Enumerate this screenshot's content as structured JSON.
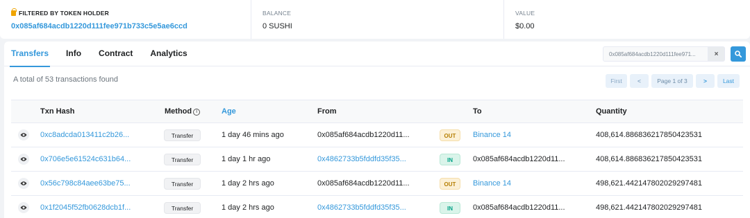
{
  "summary": {
    "holder_label": "FILTERED BY TOKEN HOLDER",
    "holder_address": "0x085af684acdb1220d111fee971b733c5e5ae6ccd",
    "balance_label": "BALANCE",
    "balance_value": "0 SUSHI",
    "value_label": "VALUE",
    "value_value": "$0.00"
  },
  "tabs": [
    {
      "label": "Transfers",
      "active": true
    },
    {
      "label": "Info"
    },
    {
      "label": "Contract"
    },
    {
      "label": "Analytics"
    }
  ],
  "search": {
    "value": "0x085af684acdb1220d111fee971...",
    "clear": "×"
  },
  "total_text": "A total of 53 transactions found",
  "pager": {
    "first": "First",
    "prev": "<",
    "page": "Page 1 of 3",
    "next": ">",
    "last": "Last"
  },
  "table": {
    "headers": {
      "txn_hash": "Txn Hash",
      "method": "Method",
      "info": "i",
      "age": "Age",
      "from": "From",
      "to": "To",
      "quantity": "Quantity"
    },
    "rows": [
      {
        "hash": "0xc8adcda013411c2b26...",
        "method": "Transfer",
        "age": "1 day 46 mins ago",
        "from": "0x085af684acdb1220d11...",
        "dir": "OUT",
        "to": "Binance 14",
        "quantity": "408,614.886836217850423531"
      },
      {
        "hash": "0x706e5e61524c631b64...",
        "method": "Transfer",
        "age": "1 day 1 hr ago",
        "from": "0x4862733b5fddfd35f35...",
        "dir": "IN",
        "to": "0x085af684acdb1220d11...",
        "quantity": "408,614.886836217850423531"
      },
      {
        "hash": "0x56c798c84aee63be75...",
        "method": "Transfer",
        "age": "1 day 2 hrs ago",
        "from": "0x085af684acdb1220d11...",
        "dir": "OUT",
        "to": "Binance 14",
        "quantity": "498,621.442147802029297481"
      },
      {
        "hash": "0x1f2045f52fb0628dcb1f...",
        "method": "Transfer",
        "age": "1 day 2 hrs ago",
        "from": "0x4862733b5fddfd35f35...",
        "dir": "IN",
        "to": "0x085af684acdb1220d11...",
        "quantity": "498,621.442147802029297481"
      }
    ]
  },
  "colors": {
    "accent": "#3498db",
    "out_badge": "#fcf0d6",
    "in_badge": "#daf4ea",
    "lock": "#f0a500"
  },
  "icons": {
    "holder": "lock-icon",
    "search": "search-icon",
    "clear": "close-icon",
    "row": "eye-icon",
    "method_info": "info-icon"
  }
}
